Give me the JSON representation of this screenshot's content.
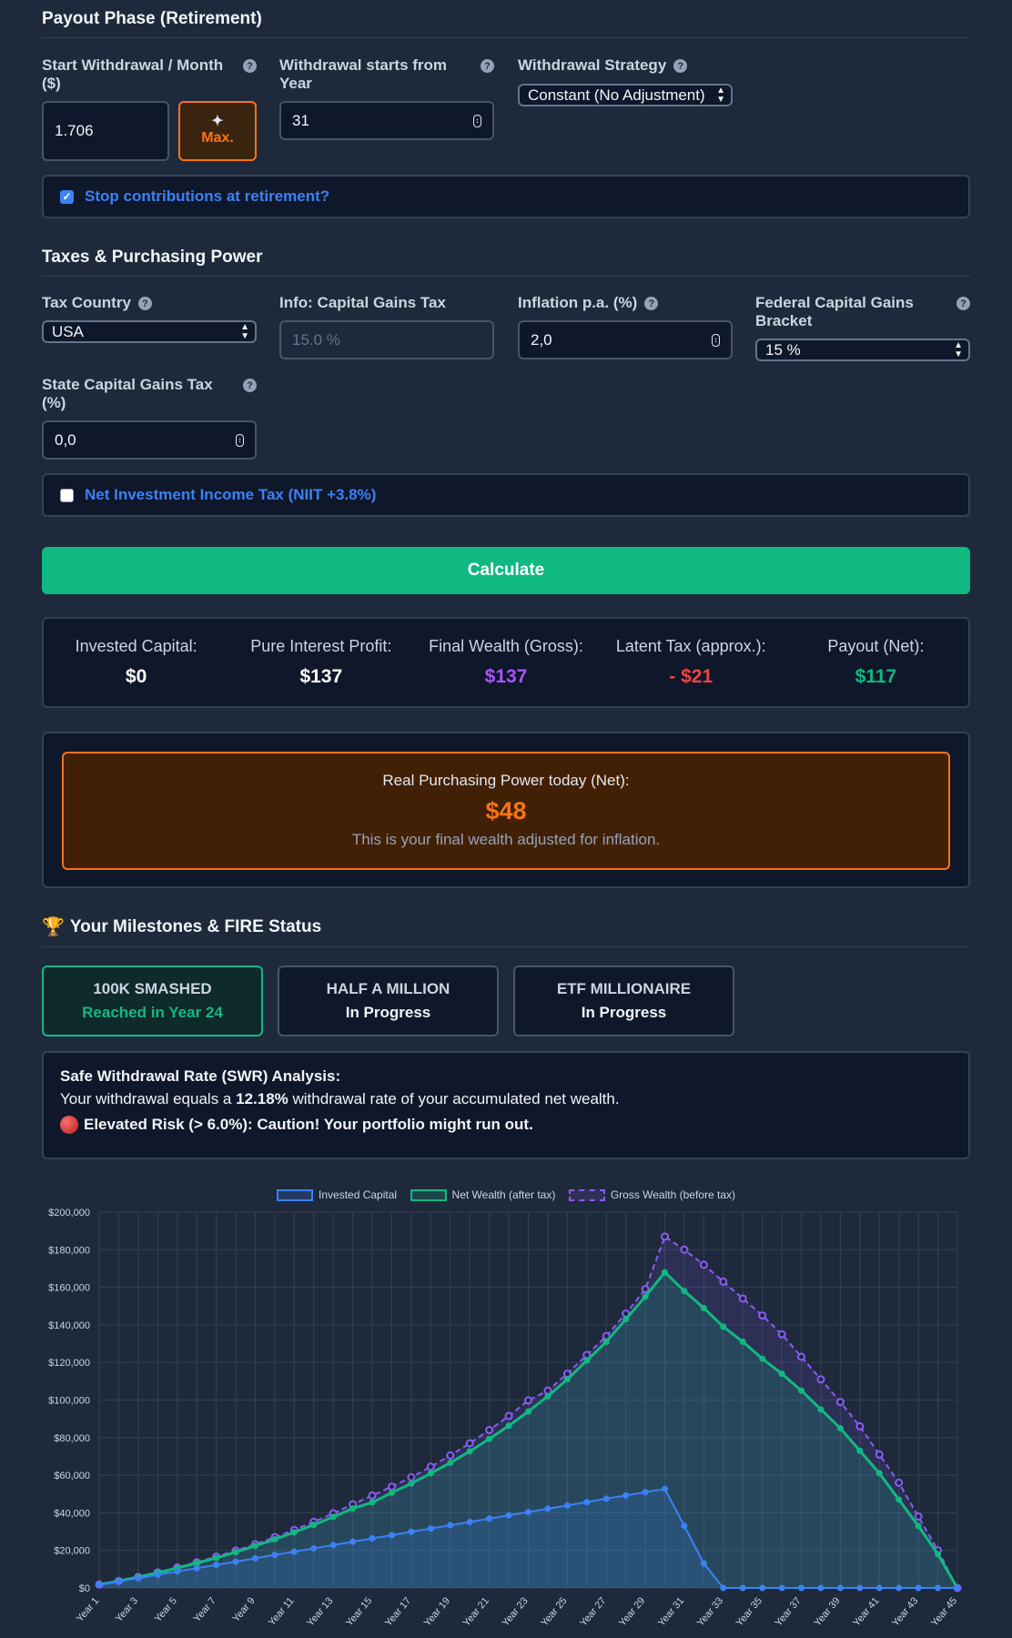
{
  "payout": {
    "title": "Payout Phase (Retirement)",
    "start_withdrawal_label": "Start Withdrawal / Month ($)",
    "start_withdrawal_value": "1.706",
    "max_label": "Max.",
    "withdrawal_year_label": "Withdrawal starts from Year",
    "withdrawal_year_value": "31",
    "strategy_label": "Withdrawal Strategy",
    "strategy_value": "Constant (No Adjustment)",
    "stop_contrib_label": "Stop contributions at retirement?"
  },
  "taxes": {
    "title": "Taxes & Purchasing Power",
    "country_label": "Tax Country",
    "country_value": "USA",
    "cgt_label": "Info: Capital Gains Tax",
    "cgt_placeholder": "15.0 %",
    "inflation_label": "Inflation p.a. (%)",
    "inflation_value": "2,0",
    "federal_label": "Federal Capital Gains Bracket",
    "federal_value": "15 %",
    "state_label": "State Capital Gains Tax (%)",
    "state_value": "0,0",
    "niit_label": "Net Investment Income Tax (NIIT +3.8%)"
  },
  "calculate_label": "Calculate",
  "stats": [
    {
      "label": "Invested Capital:",
      "value": "$0",
      "color": "#ffffff"
    },
    {
      "label": "Pure Interest Profit:",
      "value": "$137",
      "color": "#ffffff"
    },
    {
      "label": "Final Wealth (Gross):",
      "value": "$137",
      "color": "#a855f7"
    },
    {
      "label": "Latent Tax (approx.):",
      "value": "- $21",
      "color": "#ef4444"
    },
    {
      "label": "Payout (Net):",
      "value": "$117",
      "color": "#10b981"
    }
  ],
  "purchasing_power": {
    "label": "Real Purchasing Power today (Net):",
    "value": "$48",
    "note": "This is your final wealth adjusted for inflation."
  },
  "milestones": {
    "title": "Your Milestones & FIRE Status",
    "items": [
      {
        "name": "100K SMASHED",
        "status": "Reached in Year 24"
      },
      {
        "name": "HALF A MILLION",
        "status": "In Progress"
      },
      {
        "name": "ETF MILLIONAIRE",
        "status": "In Progress"
      }
    ]
  },
  "swr": {
    "title": "Safe Withdrawal Rate (SWR) Analysis:",
    "line_prefix": "Your withdrawal equals a ",
    "rate": "12.18%",
    "line_suffix": " withdrawal rate of your accumulated net wealth.",
    "risk": "Elevated Risk (> 6.0%): Caution! Your portfolio might run out."
  },
  "chart_data": {
    "type": "line",
    "x": [
      "Year 1",
      "Year 2",
      "Year 3",
      "Year 4",
      "Year 5",
      "Year 6",
      "Year 7",
      "Year 8",
      "Year 9",
      "Year 10",
      "Year 11",
      "Year 12",
      "Year 13",
      "Year 14",
      "Year 15",
      "Year 16",
      "Year 17",
      "Year 18",
      "Year 19",
      "Year 20",
      "Year 21",
      "Year 22",
      "Year 23",
      "Year 24",
      "Year 25",
      "Year 26",
      "Year 27",
      "Year 28",
      "Year 29",
      "Year 30",
      "Year 31",
      "Year 32",
      "Year 33",
      "Year 34",
      "Year 35",
      "Year 36",
      "Year 37",
      "Year 38",
      "Year 39",
      "Year 40",
      "Year 41",
      "Year 42",
      "Year 43",
      "Year 44",
      "Year 45"
    ],
    "x_tick_labels": [
      "Year 1",
      "Year 3",
      "Year 5",
      "Year 7",
      "Year 9",
      "Year 11",
      "Year 13",
      "Year 15",
      "Year 17",
      "Year 19",
      "Year 21",
      "Year 23",
      "Year 25",
      "Year 27",
      "Year 29",
      "Year 31",
      "Year 33",
      "Year 35",
      "Year 37",
      "Year 39",
      "Year 41",
      "Year 43",
      "Year 45"
    ],
    "ylim": [
      0,
      200000
    ],
    "y_ticks": [
      "$0",
      "$20,000",
      "$40,000",
      "$60,000",
      "$80,000",
      "$100,000",
      "$120,000",
      "$140,000",
      "$160,000",
      "$180,000",
      "$200,000"
    ],
    "series": [
      {
        "name": "Invested Capital",
        "color": "#3b82f6",
        "values": [
          1700,
          3500,
          5200,
          7000,
          8800,
          10500,
          12300,
          14000,
          15800,
          17600,
          19300,
          21100,
          22800,
          24600,
          26400,
          28100,
          29900,
          31600,
          33400,
          35100,
          36900,
          38700,
          40400,
          42200,
          43900,
          45700,
          47500,
          49200,
          51000,
          52700,
          33000,
          13000,
          0,
          0,
          0,
          0,
          0,
          0,
          0,
          0,
          0,
          0,
          0,
          0,
          0
        ]
      },
      {
        "name": "Net Wealth (after tax)",
        "color": "#10b981",
        "values": [
          1800,
          3700,
          5800,
          8100,
          10600,
          13200,
          16000,
          19100,
          22400,
          25900,
          29600,
          33600,
          37800,
          42300,
          45500,
          50700,
          55600,
          61000,
          66600,
          72700,
          79300,
          86300,
          93900,
          102000,
          111000,
          121000,
          131000,
          143000,
          155000,
          168000,
          158000,
          149000,
          139000,
          131000,
          122000,
          114000,
          105000,
          95000,
          85000,
          73000,
          61000,
          47000,
          33000,
          18000,
          0
        ]
      },
      {
        "name": "Gross Wealth (before tax)",
        "color": "#8b5cf6",
        "values": [
          1800,
          3700,
          5900,
          8300,
          10900,
          13700,
          16700,
          19900,
          23300,
          27000,
          30900,
          35200,
          39700,
          44500,
          49200,
          53900,
          58900,
          64500,
          70500,
          77000,
          84000,
          91500,
          99800,
          105000,
          114000,
          124000,
          134000,
          146000,
          159000,
          187000,
          180000,
          172000,
          163000,
          154000,
          145000,
          135000,
          123000,
          111000,
          99000,
          86000,
          71000,
          56000,
          38000,
          20000,
          0
        ]
      }
    ]
  }
}
